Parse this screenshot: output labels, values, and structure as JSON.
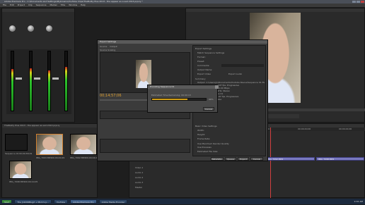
{
  "window": {
    "title": "Adobe Premiere Pro - C:\\Documents and Settings\\Mybrowns\\YouTube Clips\\TheBuilty Plus 2013 - the appear as a sad 2013.prproj *"
  },
  "menu": [
    "File",
    "Edit",
    "Project",
    "Clip",
    "Sequence",
    "Marker",
    "Title",
    "Window",
    "Help"
  ],
  "project": {
    "title": "TheBuilty Plus 2013 - the appear as sad 2013.prproj"
  },
  "project_items": [
    {
      "name": "Sequence 01",
      "duration": "00;00;58;29"
    },
    {
      "name": "IMG_7093.MP4",
      "duration": "00;00;40;29"
    },
    {
      "name": "IMG_7092.MP4",
      "duration": "00;00;04;05"
    },
    {
      "name": "IMG_7098.MP4",
      "duration": "00;00;10;05"
    }
  ],
  "export_dialog": {
    "title": "Export Settings",
    "tabs": [
      "Source",
      "Output"
    ],
    "source_scaling": "Source Scaling",
    "timecode": "00;14;57;06",
    "fit": "Fit",
    "export_settings_header": "Export Settings",
    "match_sequence": "Match Sequence Settings",
    "format_label": "Format:",
    "preset_label": "Preset:",
    "comments_label": "Comments:",
    "output_name_label": "Output Name:",
    "export_video": "Export Video",
    "export_audio": "Export Audio",
    "summary_header": "Summary",
    "summary_lines": [
      "Output: C:\\Users\\Jn\\Documents\\Youtube Revue\\Sequence 01.flv",
      "H.264, 640x480, 29.97 fps, Progressive",
      "VBR, 1 pass, Target 4.00 Mbps",
      "AAC, 128 kbps, 48 kHz, Stereo",
      "Sequence, Sequence 01",
      "1280x720 (1.0), 29.97 fps, Progressive",
      "No Summary Available"
    ],
    "queue_label": "Queue",
    "export_label": "Export",
    "cancel_label": "Cancel",
    "metadata_label": "Metadata...",
    "basic_video_settings": "Basic Video Settings",
    "width_label": "Width:",
    "height_label": "Height:",
    "frame_rate_label": "Frame Rate:",
    "use_max_render": "Use Maximum Render Quality",
    "use_previews": "Use Previews",
    "estimated_file_size": "Estimated File Size:"
  },
  "encoding_dialog": {
    "title": "Encoding Sequence 01",
    "remaining_label": "Estimated Time Remaining: 00:00:13",
    "progress_percent": 66,
    "progress_text": "66%",
    "cancel_label": "Cancel"
  },
  "timeline": {
    "tracks": [
      "Video 1",
      "Audio 1",
      "Audio 2",
      "Audio 3",
      "Master"
    ],
    "clips": [
      {
        "label": "IMG_7093.MP4 [V] Opacity:Opacity"
      },
      {
        "label": "IMG_7092.MP4"
      },
      {
        "label": "IMG_7098.MP4"
      }
    ],
    "ruler": [
      "00;00;32;00",
      "00;00;36;00",
      "00;00;40;00",
      "00;00;44;00"
    ]
  },
  "taskbar": {
    "start": "Start",
    "tasks": [
      "The Jn1000Bug2 + Mom's p...",
      "YouTube",
      "Adobe Premiere Pro",
      "Adobe Media Encoder"
    ],
    "clock": "9:32 AM"
  },
  "colors": {
    "progress": "#d4a017",
    "clip": "#7a7ac0",
    "taskbar": "#1c2a3e"
  }
}
